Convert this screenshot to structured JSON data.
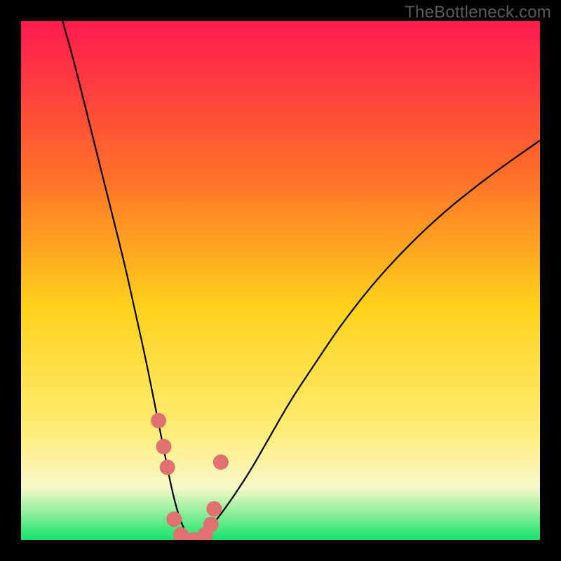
{
  "watermark": "TheBottleneck.com",
  "colors": {
    "frame": "#000000",
    "gradient_top": "#ff1a4e",
    "gradient_mid_upper": "#ff6a2a",
    "gradient_mid": "#ffd21a",
    "gradient_mid_lower": "#ffec70",
    "gradient_pale": "#f7f9c8",
    "gradient_bottom": "#17e36a",
    "curve_stroke": "#000000",
    "marker_fill": "#e0716e"
  },
  "chart_data": {
    "type": "line",
    "title": "",
    "xlabel": "",
    "ylabel": "",
    "xlim": [
      0,
      100
    ],
    "ylim": [
      0,
      100
    ],
    "series": [
      {
        "name": "bottleneck-curve",
        "x": [
          8,
          10,
          12,
          14,
          16,
          18,
          20,
          22,
          24,
          26,
          27,
          28,
          29,
          30,
          31,
          32,
          33,
          34,
          35,
          37,
          40,
          44,
          48,
          52,
          56,
          62,
          70,
          80,
          90,
          100
        ],
        "values": [
          100,
          93,
          85,
          77,
          69,
          61,
          53,
          44,
          35,
          25,
          20,
          15,
          10,
          6,
          3,
          1,
          0,
          0,
          1,
          3,
          7,
          13,
          20,
          27,
          33,
          42,
          52,
          62,
          70,
          77
        ]
      }
    ],
    "markers": {
      "name": "highlighted-points",
      "x": [
        26.5,
        27.5,
        28.2,
        29.5,
        30.8,
        32.0,
        33.3,
        34.5,
        35.5,
        36.6,
        37.2,
        38.5
      ],
      "y": [
        23,
        18,
        14,
        4,
        1,
        0,
        0,
        0,
        1,
        3,
        6,
        15
      ]
    }
  }
}
